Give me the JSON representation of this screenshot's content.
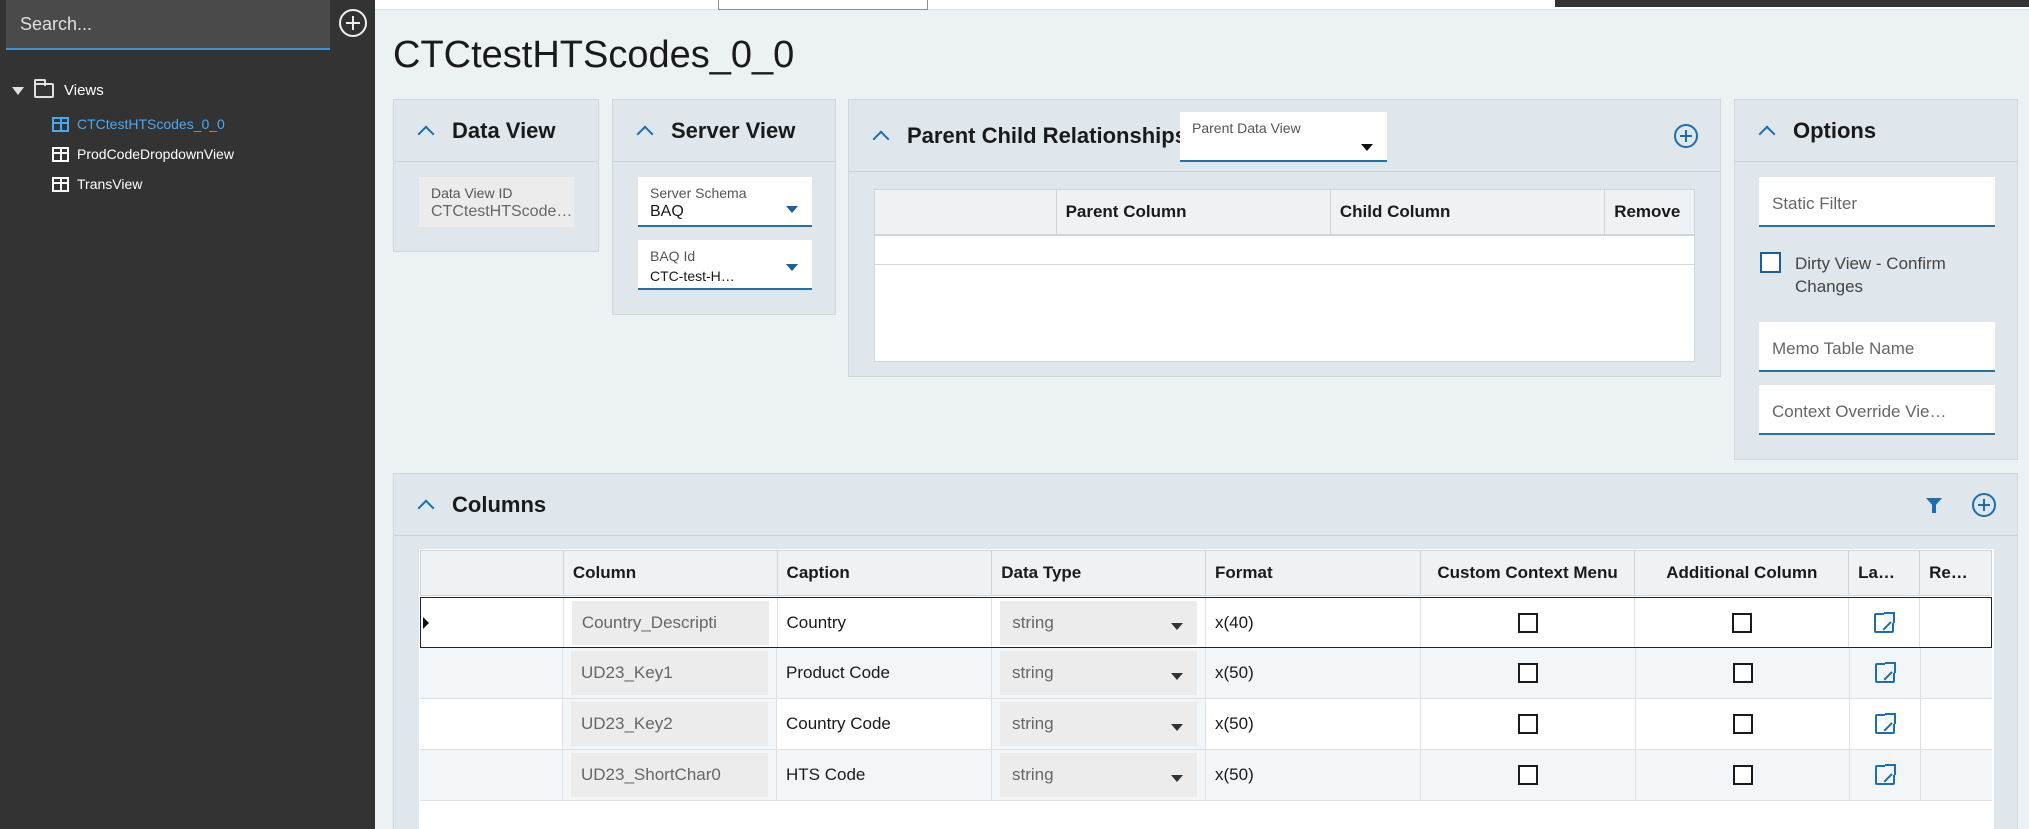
{
  "sidebar": {
    "search_placeholder": "Search...",
    "root_label": "Views",
    "items": [
      {
        "label": "CTCtestHTScodes_0_0",
        "active": true
      },
      {
        "label": "ProdCodeDropdownView",
        "active": false
      },
      {
        "label": "TransView",
        "active": false
      }
    ]
  },
  "page_title": "CTCtestHTScodes_0_0",
  "data_view": {
    "title": "Data View",
    "id_label": "Data View ID",
    "id_value": "CTCtestHTScode…"
  },
  "server_view": {
    "title": "Server View",
    "schema_label": "Server Schema",
    "schema_value": "BAQ",
    "baq_label": "BAQ Id",
    "baq_value": "CTC-test-H…"
  },
  "parent_child": {
    "title": "Parent Child Relationships",
    "parent_dv_label": "Parent Data View",
    "parent_dv_value": "",
    "columns": [
      "",
      "Parent Column",
      "Child Column",
      "Remove"
    ]
  },
  "options": {
    "title": "Options",
    "static_filter": "Static Filter",
    "dirty_view": "Dirty View - Confirm Changes",
    "memo_table": "Memo Table Name",
    "context_override": "Context Override Vie…"
  },
  "columns_panel": {
    "title": "Columns",
    "headers": [
      "",
      "Column",
      "Caption",
      "Data Type",
      "Format",
      "Custom Context Menu",
      "Additional Column",
      "La…",
      "Re…"
    ],
    "rows": [
      {
        "column": "Country_Descripti",
        "caption": "Country",
        "data_type": "string",
        "format": "x(40)",
        "custom_ctx": false,
        "additional": false
      },
      {
        "column": "UD23_Key1",
        "caption": "Product Code",
        "data_type": "string",
        "format": "x(50)",
        "custom_ctx": false,
        "additional": false
      },
      {
        "column": "UD23_Key2",
        "caption": "Country Code",
        "data_type": "string",
        "format": "x(50)",
        "custom_ctx": false,
        "additional": false
      },
      {
        "column": "UD23_ShortChar0",
        "caption": "HTS Code",
        "data_type": "string",
        "format": "x(50)",
        "custom_ctx": false,
        "additional": false
      }
    ]
  }
}
